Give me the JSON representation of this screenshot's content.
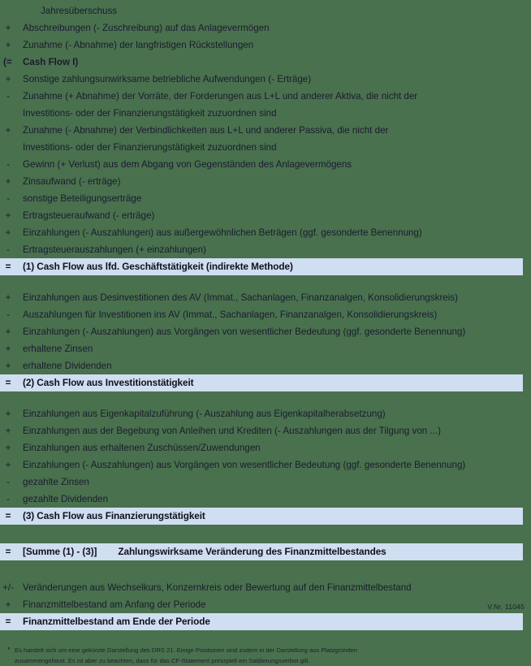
{
  "document": {
    "title": "Cash Flow Statement (DRS 21) - gekürzte Darstellung",
    "background_color": "#49714e",
    "band_color": "#cfdef0",
    "text_color": "#1b1b2e"
  },
  "opening": {
    "label": "Jahresüberschuss"
  },
  "section_cash_flow_1": {
    "rows": [
      {
        "sign": "+",
        "label": "Abschreibungen (- Zuschreibung) auf das Anlagevermögen"
      },
      {
        "sign": "+",
        "label": "Zunahme (- Abnahme) der langfristigen Rückstellungen"
      }
    ]
  },
  "cash_flow_1_total": {
    "sign": "(=",
    "label": "Cash Flow I)"
  },
  "section_operating": {
    "rows": [
      {
        "sign": "+",
        "label": "Sonstige zahlungsunwirksame betriebliche Aufwendungen (- Erträge)"
      },
      {
        "sign": "-",
        "label": "Zunahme (+ Abnahme) der Vorräte, der Forderungen aus L+L und anderer Aktiva, die nicht der"
      },
      {
        "sign": "",
        "label": "Investitions- oder der Finanzierungstätigkeit zuzuordnen sind",
        "continuation": true
      },
      {
        "sign": "+",
        "label": "Zunahme (- Abnahme) der Verbindlichkeiten aus L+L und anderer Passiva, die nicht der"
      },
      {
        "sign": "",
        "label": "Investitions- oder der Finanzierungstätigkeit zuzuordnen sind",
        "continuation": true
      },
      {
        "sign": "-",
        "label": "Gewinn (+ Verlust) aus dem Abgang von Gegenständen des Anlagevermögens"
      },
      {
        "sign": "+",
        "label": "Zinsaufwand (- erträge)"
      },
      {
        "sign": "-",
        "label": "sonstige Beteiligungserträge"
      },
      {
        "sign": "+",
        "label": "Ertragsteueraufwand (- erträge)"
      },
      {
        "sign": "+",
        "label": "Einzahlungen (- Auszahlungen) aus außergewöhnlichen Beträgen (ggf. gesonderte Benennung)"
      },
      {
        "sign": "-",
        "label": "Ertragsteuerauszahlungen  (+ einzahlungen)"
      }
    ]
  },
  "total_1": {
    "sign": "=",
    "label": "(1) Cash Flow aus lfd. Geschäftstätigkeit (indirekte Methode)"
  },
  "section_investing": {
    "rows": [
      {
        "sign": "+",
        "label": "Einzahlungen aus Desinvestitionen des AV (Immat., Sachanlagen, Finanzanalgen, Konsolidierungskreis)"
      },
      {
        "sign": "-",
        "label": "Auszahlungen für Investitionen ins AV (Immat., Sachanlagen, Finanzanalgen, Konsolidierungskreis)"
      },
      {
        "sign": "+",
        "label": "Einzahlungen (- Auszahlungen) aus Vorgängen von wesentlicher Bedeutung (ggf. gesonderte Benennung)"
      },
      {
        "sign": "+",
        "label": "erhaltene Zinsen"
      },
      {
        "sign": "+",
        "label": "erhaltene Dividenden"
      }
    ]
  },
  "total_2": {
    "sign": "=",
    "label": "(2) Cash Flow aus Investitionstätigkeit"
  },
  "section_financing": {
    "rows": [
      {
        "sign": "+",
        "label": "Einzahlungen aus Eigenkapitalzuführung (- Auszahlung aus Eigenkapitalherabsetzung)"
      },
      {
        "sign": "+",
        "label": "Einzahlungen aus der Begebung von Anleihen und Krediten (- Auszahlungen aus der Tilgung von ...)"
      },
      {
        "sign": "+",
        "label": "Einzahlungen aus erhaltenen Zuschüssen/Zuwendungen"
      },
      {
        "sign": "+",
        "label": "Einzahlungen (- Auszahlungen) aus Vorgängen von wesentlicher Bedeutung (ggf. gesonderte Benennung)"
      },
      {
        "sign": "-",
        "label": "gezahlte Zinsen"
      },
      {
        "sign": "-",
        "label": "gezahlte Dividenden"
      }
    ]
  },
  "total_3": {
    "sign": "=",
    "label": "(3) Cash Flow aus Finanzierungstätigkeit"
  },
  "total_sum": {
    "sign": "=",
    "prefix": "[Summe (1) - (3)]",
    "label": "Zahlungswirksame Veränderung des Finanzmittelbestandes"
  },
  "section_reconciliation": {
    "rows": [
      {
        "sign": "+/-",
        "label": "Veränderungen aus Wechselkurs, Konzernkreis oder Bewertung auf den Finanzmittelbestand"
      },
      {
        "sign": "+",
        "label": "Finanzmittelbestand am Anfang der Periode"
      }
    ]
  },
  "total_final": {
    "sign": "=",
    "label": "Finanzmittelbestand am Ende der Periode"
  },
  "footnote": {
    "marker": "*",
    "line1": "Es handelt sich um eine gekürzte Darstellung des DRS 21. Einige Positionen sind zudem in der Darstellung aus Platzgründen",
    "line2": "zusammengefasst. Es ist aber zu beachten, dass für das  CF-Statement prinizpiell ein Saldierungsverbot gilt."
  },
  "version": {
    "label": "V.Nr. 11045"
  }
}
